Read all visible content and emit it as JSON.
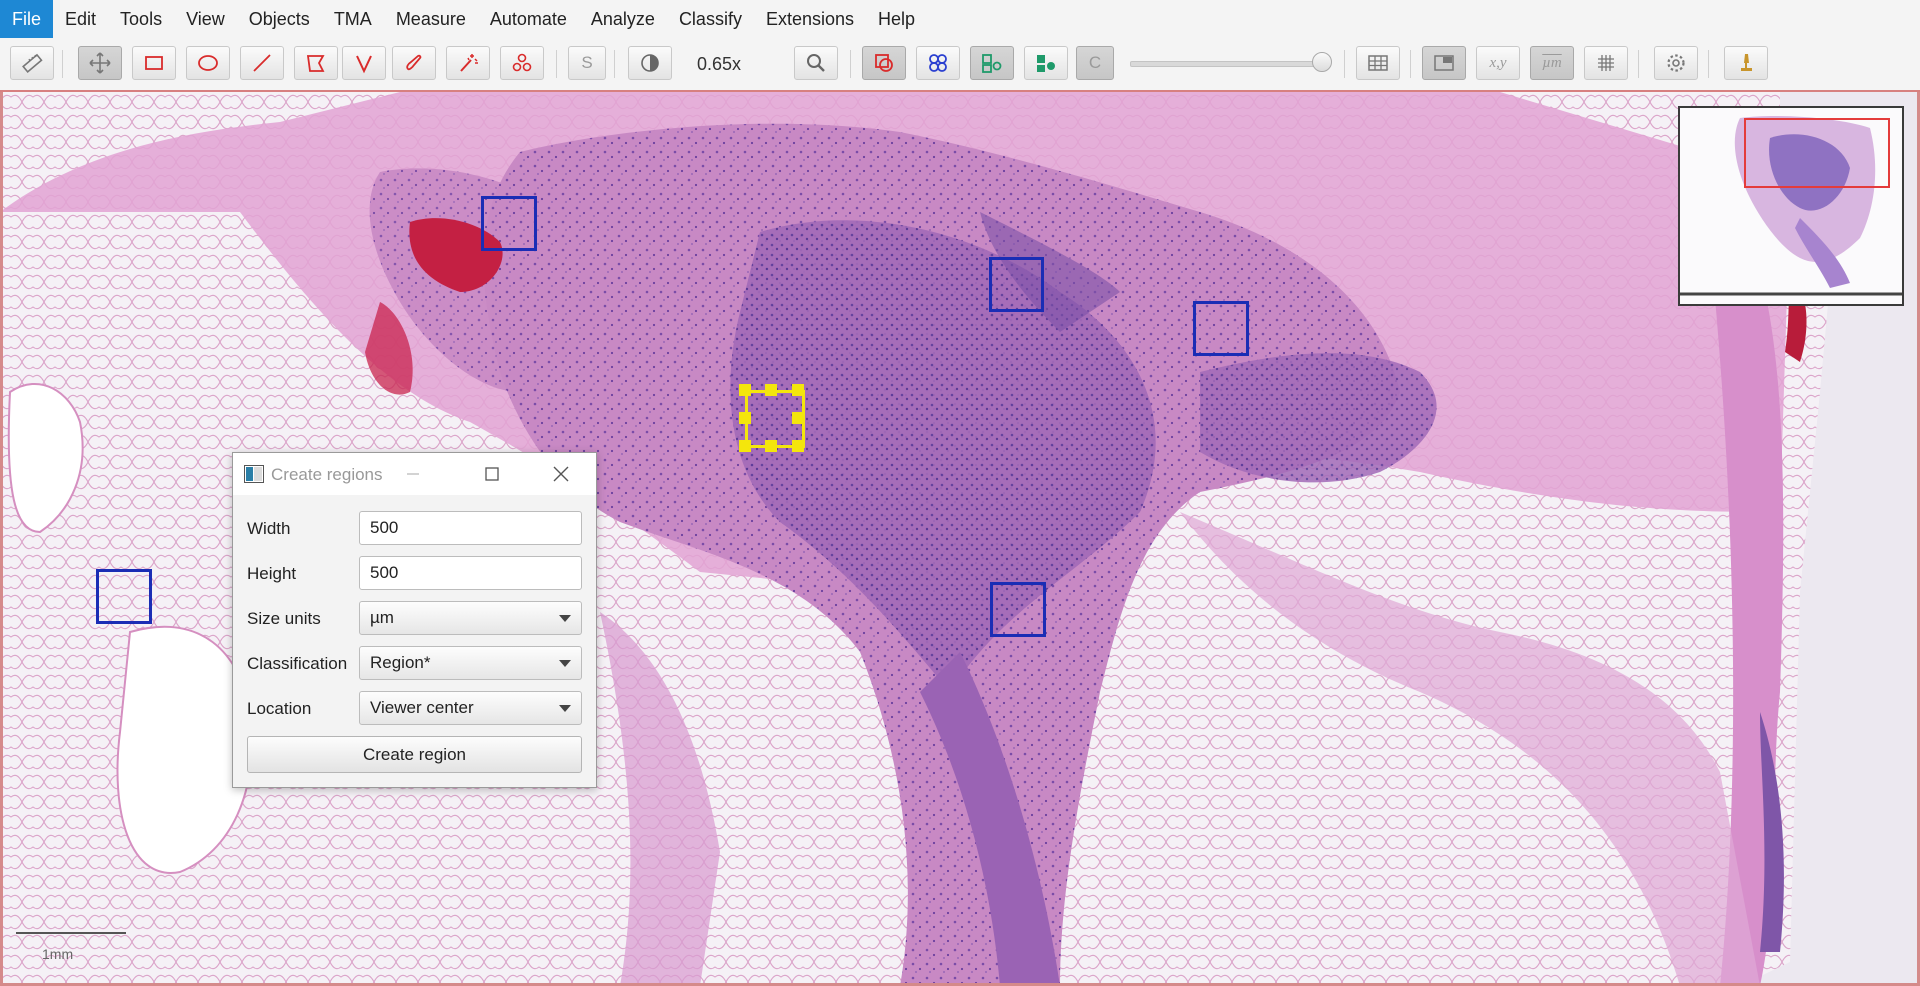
{
  "menubar": {
    "items": [
      "File",
      "Edit",
      "Tools",
      "View",
      "Objects",
      "TMA",
      "Measure",
      "Automate",
      "Analyze",
      "Classify",
      "Extensions",
      "Help"
    ],
    "active": "File"
  },
  "toolbar": {
    "zoom_label": "0.65x",
    "brightness_label": "S",
    "channel_label": "C",
    "coords_label": "x,y",
    "units_label": "µm",
    "slider_value": 1.0,
    "tools": [
      {
        "name": "measure-icon"
      },
      {
        "name": "move-icon"
      },
      {
        "name": "rectangle-icon"
      },
      {
        "name": "ellipse-icon"
      },
      {
        "name": "line-icon"
      },
      {
        "name": "polygon-icon"
      },
      {
        "name": "polyline-icon"
      },
      {
        "name": "brush-icon"
      },
      {
        "name": "wand-icon"
      },
      {
        "name": "points-icon"
      }
    ],
    "accent_red": "#d92b2b",
    "accent_blue": "#2a3fd0",
    "accent_green": "#1f9a6a"
  },
  "viewer": {
    "scalebar_label": "1mm",
    "roi_color": "#1a2db5",
    "selected_roi_color": "#f4e60c"
  },
  "dialog": {
    "title": "Create regions",
    "fields": {
      "width_label": "Width",
      "width_value": "500",
      "height_label": "Height",
      "height_value": "500",
      "size_units_label": "Size units",
      "size_units_value": "µm",
      "classification_label": "Classification",
      "classification_value": "Region*",
      "location_label": "Location",
      "location_value": "Viewer center"
    },
    "create_button": "Create region"
  }
}
